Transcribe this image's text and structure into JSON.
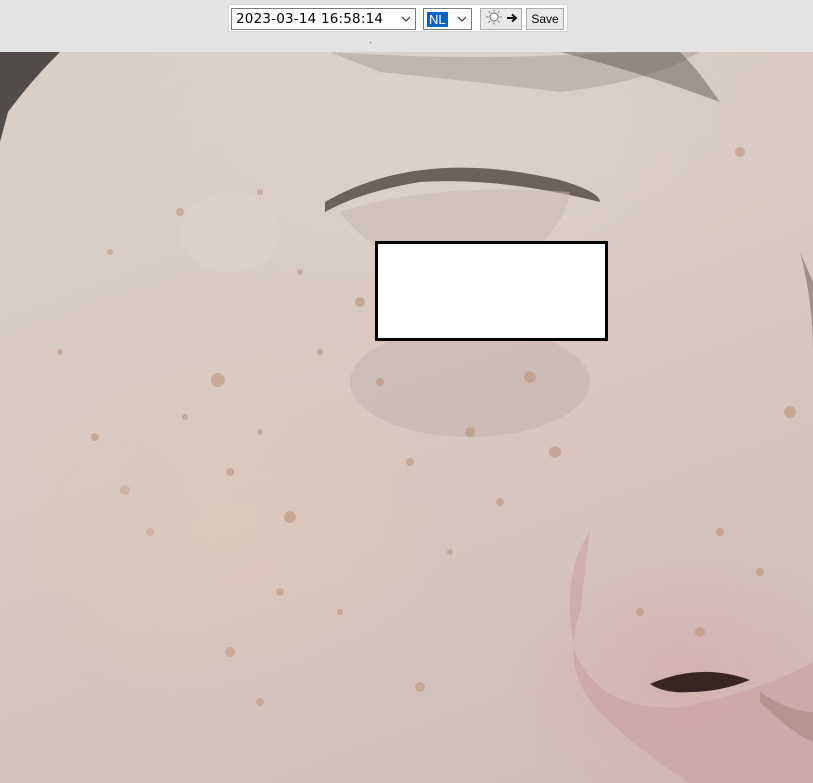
{
  "toolbar": {
    "datetime_value": "2023-03-14 16:58:14",
    "mode_value": "NL",
    "light_button_icons": [
      "bulb-icon",
      "arrow-right-icon"
    ],
    "save_label": "Save"
  },
  "colors": {
    "toolbar_bg": "#e3e3e3",
    "selected_highlight": "#0a64c8",
    "redaction_fill": "#ffffff",
    "redaction_border": "#000000"
  }
}
